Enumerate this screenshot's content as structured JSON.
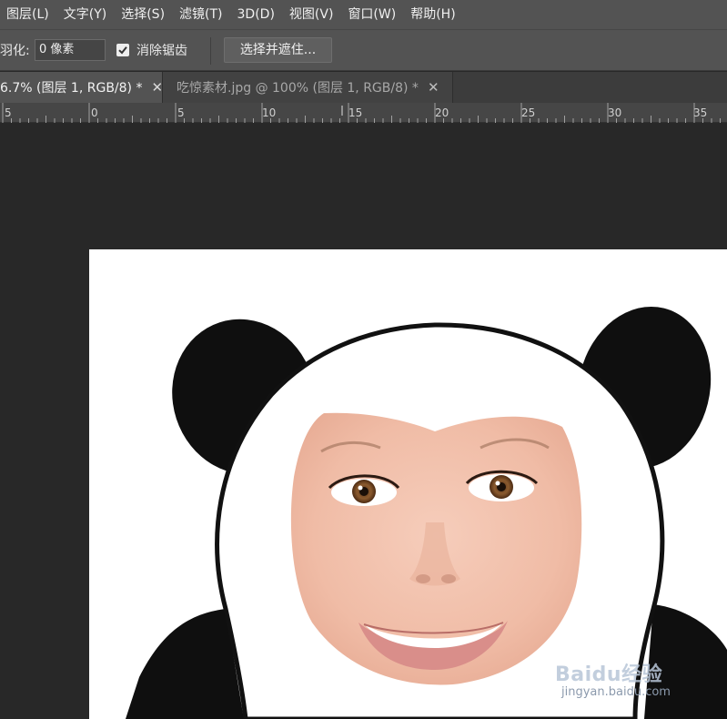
{
  "menubar": {
    "items": [
      {
        "label": "图层(L)"
      },
      {
        "label": "文字(Y)"
      },
      {
        "label": "选择(S)"
      },
      {
        "label": "滤镜(T)"
      },
      {
        "label": "3D(D)"
      },
      {
        "label": "视图(V)"
      },
      {
        "label": "窗口(W)"
      },
      {
        "label": "帮助(H)"
      }
    ]
  },
  "options": {
    "feather_label": "羽化:",
    "feather_value": "0 像素",
    "antialias_label": "消除锯齿",
    "antialias_checked": true,
    "select_mask_label": "选择并遮住..."
  },
  "tabs": [
    {
      "label": "6.7% (图层 1, RGB/8) *",
      "active": true
    },
    {
      "label": "吃惊素材.jpg @ 100% (图层 1, RGB/8) *",
      "active": false
    }
  ],
  "ruler": {
    "labels": [
      "5",
      "0",
      "5",
      "10",
      "15",
      "20",
      "25",
      "30",
      "35"
    ]
  },
  "watermark": {
    "logo": "Baidu经验",
    "url": "jingyan.baidu.com"
  },
  "colors": {
    "menubar": "#535353",
    "workspace": "#282828",
    "canvas": "#ffffff"
  }
}
